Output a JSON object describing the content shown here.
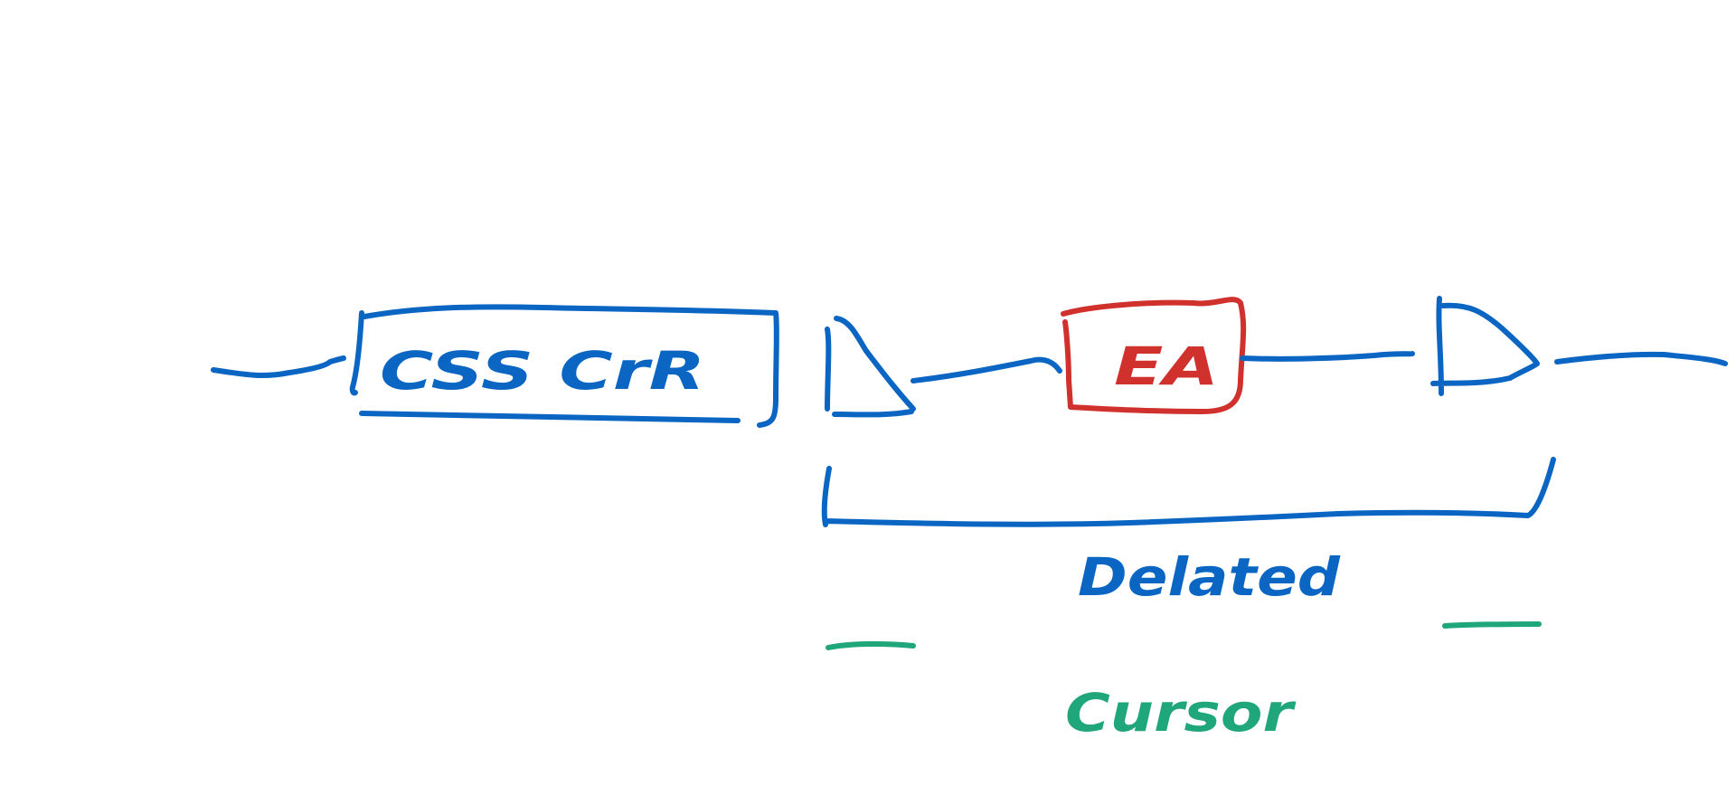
{
  "diagram": {
    "labels": {
      "csr_block": "CSS CrR",
      "ea_block": "EA",
      "delay": "Delated",
      "cursor": "Cursor"
    },
    "colors": {
      "blue_ink": "#0b66c3",
      "red_ink": "#d0312d",
      "green_ink": "#1fa67a",
      "background": "#ffffff"
    }
  }
}
